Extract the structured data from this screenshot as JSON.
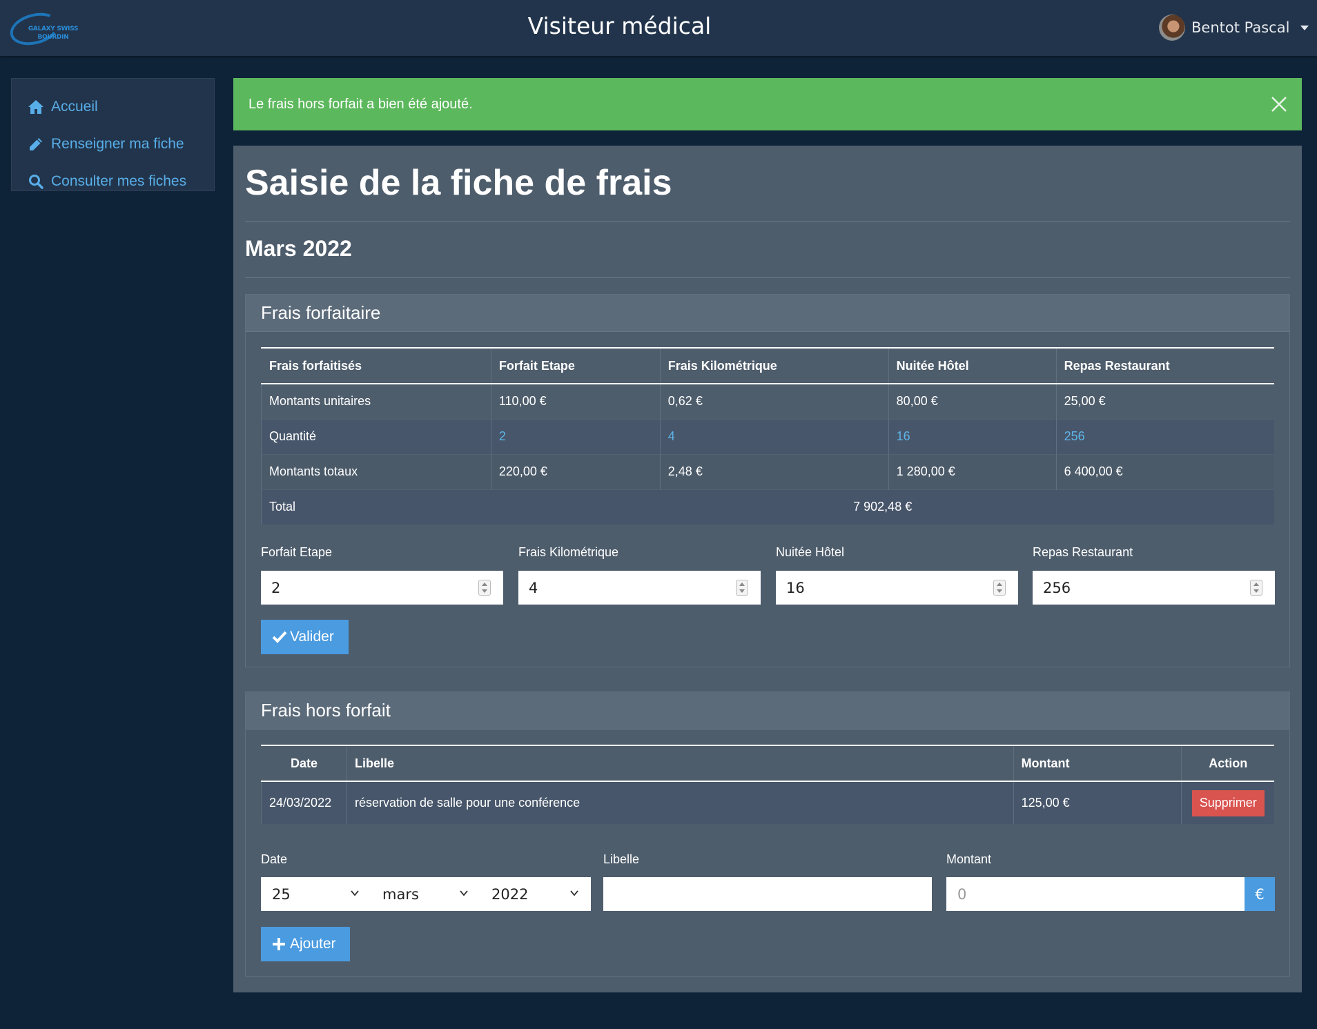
{
  "app": {
    "title": "Visiteur médical",
    "logo_text_line1": "GALAXY SWISS",
    "logo_text_line2": "BOURDIN",
    "user_name": "Bentot Pascal"
  },
  "sidebar": {
    "items": [
      {
        "label": "Accueil",
        "icon": "home-icon"
      },
      {
        "label": "Renseigner ma fiche",
        "icon": "pencil-icon"
      },
      {
        "label": "Consulter mes fiches",
        "icon": "search-icon"
      }
    ]
  },
  "alert": {
    "message": "Le frais hors forfait a bien été ajouté."
  },
  "page": {
    "title": "Saisie de la fiche de frais",
    "month": "Mars 2022"
  },
  "forfait": {
    "header": "Frais forfaitaire",
    "columns": [
      "Frais forfaitisés",
      "Forfait Etape",
      "Frais Kilométrique",
      "Nuitée Hôtel",
      "Repas Restaurant"
    ],
    "rows": [
      {
        "label": "Montants unitaires",
        "values": [
          "110,00 €",
          "0,62 €",
          "80,00 €",
          "25,00 €"
        ]
      },
      {
        "label": "Quantité",
        "values": [
          "2",
          "4",
          "16",
          "256"
        ]
      },
      {
        "label": "Montants totaux",
        "values": [
          "220,00 €",
          "2,48 €",
          "1 280,00 €",
          "6 400,00 €"
        ]
      }
    ],
    "total_label": "Total",
    "total_value": "7 902,48 €",
    "inputs": [
      {
        "label": "Forfait Etape",
        "value": "2"
      },
      {
        "label": "Frais Kilométrique",
        "value": "4"
      },
      {
        "label": "Nuitée Hôtel",
        "value": "16"
      },
      {
        "label": "Repas Restaurant",
        "value": "256"
      }
    ],
    "submit_label": "Valider"
  },
  "hors_forfait": {
    "header": "Frais hors forfait",
    "columns": [
      "Date",
      "Libelle",
      "Montant",
      "Action"
    ],
    "rows": [
      {
        "date": "24/03/2022",
        "libelle": "réservation de salle pour une conférence",
        "montant": "125,00 €",
        "action": "Supprimer"
      }
    ],
    "form": {
      "date_label": "Date",
      "day": "25",
      "month": "mars",
      "year": "2022",
      "libelle_label": "Libelle",
      "libelle_value": "",
      "montant_label": "Montant",
      "montant_placeholder": "0",
      "currency": "€",
      "submit_label": "Ajouter"
    }
  },
  "colors": {
    "background": "#0e2238",
    "navbar": "#22344b",
    "panel": "#4e5d6c",
    "primary": "#4a9be0",
    "success": "#5cb85c",
    "danger": "#d9534f",
    "link": "#58aee8"
  }
}
